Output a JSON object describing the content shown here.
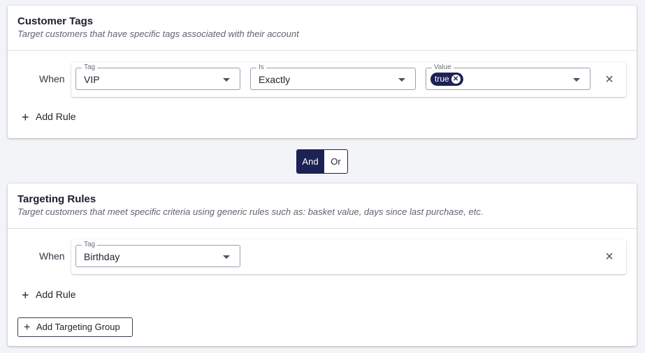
{
  "customer_tags": {
    "title": "Customer Tags",
    "subtitle": "Target customers that have specific tags associated with their account",
    "rule": {
      "when_label": "When",
      "tag_field": {
        "label": "Tag",
        "value": "VIP"
      },
      "is_field": {
        "label": "Is",
        "value": "Exactly"
      },
      "value_field": {
        "label": "Value",
        "chip": "true"
      },
      "remove_icon": "×"
    },
    "add_rule_label": "Add Rule"
  },
  "combinator": {
    "and_label": "And",
    "or_label": "Or",
    "selected": "And"
  },
  "targeting_rules": {
    "title": "Targeting Rules",
    "subtitle": "Target customers that meet specific criteria using generic rules such as: basket value, days since last purchase, etc.",
    "rule": {
      "when_label": "When",
      "tag_field": {
        "label": "Tag",
        "value": "Birthday"
      },
      "remove_icon": "×"
    },
    "add_rule_label": "Add Rule",
    "add_group_label": "Add Targeting Group"
  },
  "colors": {
    "accent": "#1c2254",
    "background": "#f2f4f7"
  }
}
